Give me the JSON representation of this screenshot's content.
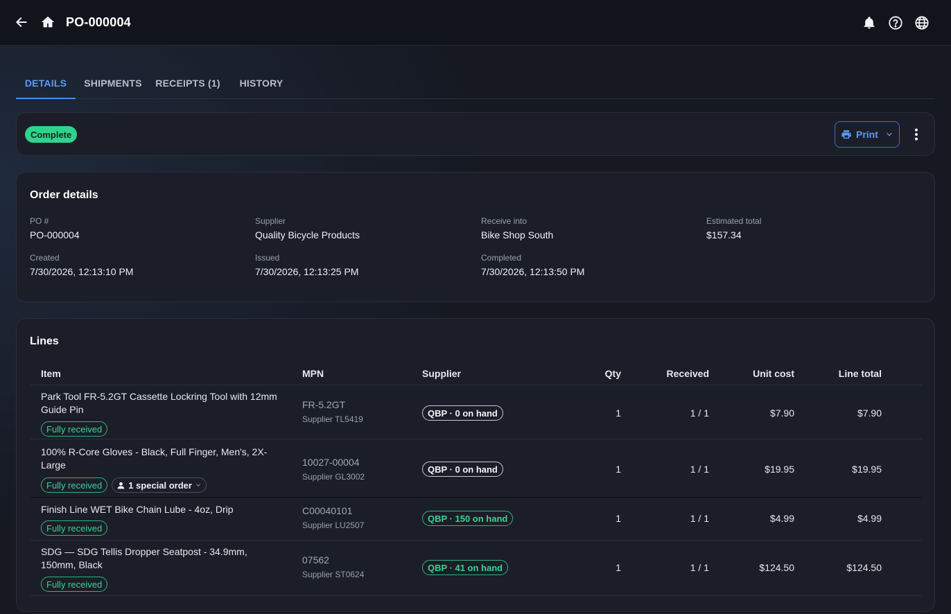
{
  "header": {
    "title": "PO-000004"
  },
  "tabs": [
    {
      "label": "DETAILS",
      "active": true
    },
    {
      "label": "SHIPMENTS",
      "active": false
    },
    {
      "label": "RECEIPTS (1)",
      "active": false
    },
    {
      "label": "HISTORY",
      "active": false
    }
  ],
  "status": {
    "badge": "Complete",
    "print_label": "Print"
  },
  "order_details": {
    "title": "Order details",
    "fields": [
      {
        "label": "PO #",
        "value": "PO-000004"
      },
      {
        "label": "Supplier",
        "value": "Quality Bicycle Products"
      },
      {
        "label": "Receive into",
        "value": "Bike Shop South"
      },
      {
        "label": "Estimated total",
        "value": "$157.34"
      },
      {
        "label": "Created",
        "value": "7/30/2026, 12:13:10 PM"
      },
      {
        "label": "Issued",
        "value": "7/30/2026, 12:13:25 PM"
      },
      {
        "label": "Completed",
        "value": "7/30/2026, 12:13:50 PM"
      }
    ]
  },
  "lines": {
    "title": "Lines",
    "columns": [
      "Item",
      "MPN",
      "Supplier",
      "Qty",
      "Received",
      "Unit cost",
      "Line total"
    ],
    "rows": [
      {
        "item": "Park Tool FR-5.2GT Cassette Lockring Tool with 12mm Guide Pin",
        "status": "Fully received",
        "mpn": "FR-5.2GT",
        "supplier_code": "Supplier TL5419",
        "supplier_stock": "QBP · 0 on hand",
        "qty": "1",
        "received": "1 / 1",
        "unit_cost": "$7.90",
        "line_total": "$7.90"
      },
      {
        "item": "100% R-Core Gloves - Black, Full Finger, Men's, 2X-Large",
        "status": "Fully received",
        "special_order": "1 special order",
        "mpn": "10027-00004",
        "supplier_code": "Supplier GL3002",
        "supplier_stock": "QBP · 0 on hand",
        "qty": "1",
        "received": "1 / 1",
        "unit_cost": "$19.95",
        "line_total": "$19.95"
      },
      {
        "item": "Finish Line WET Bike Chain Lube - 4oz, Drip",
        "status": "Fully received",
        "mpn": "C00040101",
        "supplier_code": "Supplier LU2507",
        "supplier_stock": "QBP · 150 on hand",
        "qty": "1",
        "received": "1 / 1",
        "unit_cost": "$4.99",
        "line_total": "$4.99"
      },
      {
        "item": "SDG — SDG Tellis Dropper Seatpost - 34.9mm, 150mm, Black",
        "status": "Fully received",
        "mpn": "07562",
        "supplier_code": "Supplier ST0624",
        "supplier_stock": "QBP · 41 on hand",
        "qty": "1",
        "received": "1 / 1",
        "unit_cost": "$124.50",
        "line_total": "$124.50"
      }
    ]
  },
  "icons": {
    "back": "arrow-left-icon",
    "home": "home-icon",
    "notifications": "bell-icon",
    "help": "help-circle-icon",
    "language": "globe-icon",
    "print": "printer-icon",
    "more": "more-vertical-icon",
    "person": "person-icon"
  },
  "colors": {
    "accent": "#4c8cf0",
    "success": "#2fd38e",
    "background": "#161922",
    "card": "#1b1e28"
  }
}
